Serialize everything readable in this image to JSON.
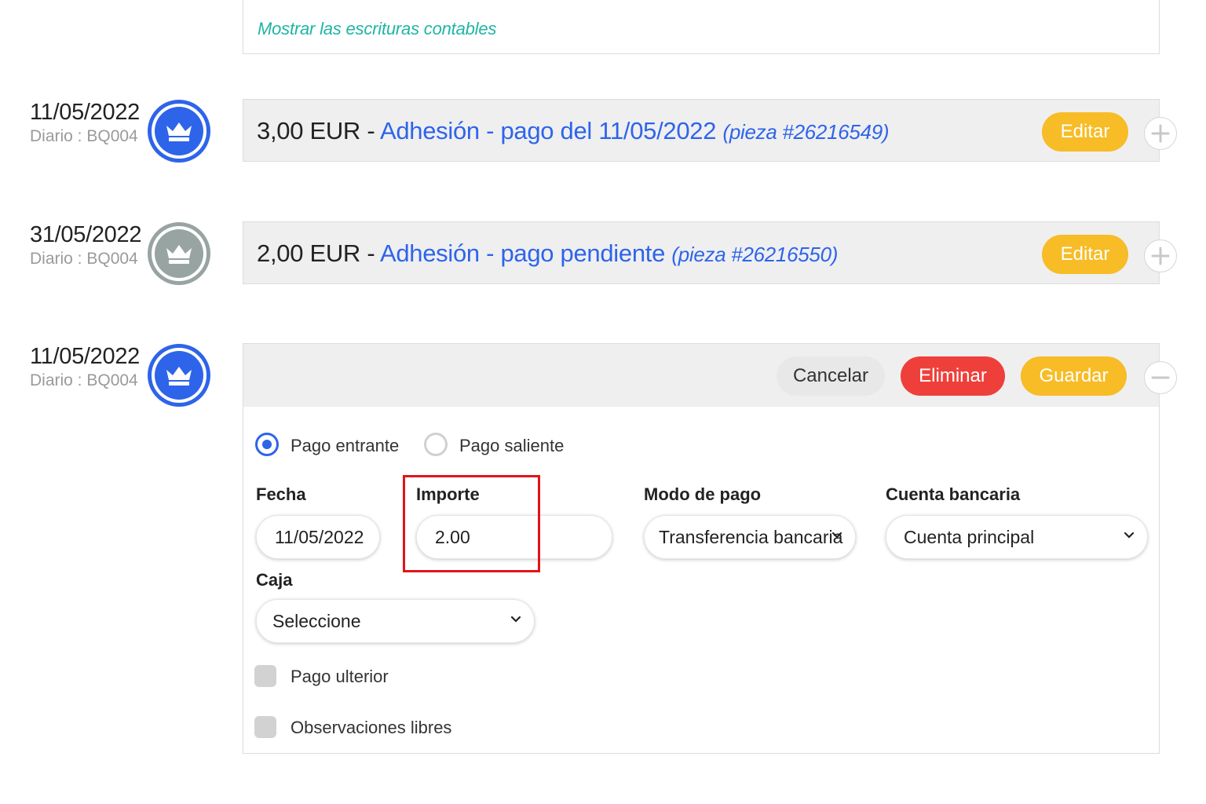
{
  "top": {
    "link": "Mostrar las escrituras contables"
  },
  "entries": [
    {
      "date": "11/05/2022",
      "journal": "Diario : BQ004",
      "amount": "3,00 EUR",
      "sep": " - ",
      "title": "Adhesión - pago del 11/05/2022",
      "piece": "(pieza #26216549)",
      "edit_label": "Editar",
      "status_color": "#2e64ea"
    },
    {
      "date": "31/05/2022",
      "journal": "Diario : BQ004",
      "amount": "2,00 EUR",
      "sep": " - ",
      "title": "Adhesión - pago pendiente",
      "piece": "(pieza #26216550)",
      "edit_label": "Editar",
      "status_color": "#98a4a2"
    }
  ],
  "editing": {
    "date": "11/05/2022",
    "journal": "Diario : BQ004",
    "cancel_label": "Cancelar",
    "delete_label": "Eliminar",
    "save_label": "Guardar",
    "direction": {
      "incoming": "Pago entrante",
      "outgoing": "Pago saliente",
      "selected": "incoming"
    },
    "fields": {
      "fecha_label": "Fecha",
      "fecha_value": "11/05/2022",
      "importe_label": "Importe",
      "importe_value": "2.00",
      "modo_label": "Modo de pago",
      "modo_value": "Transferencia bancaria",
      "cuenta_label": "Cuenta bancaria",
      "cuenta_value": "Cuenta principal",
      "caja_label": "Caja",
      "caja_value": "Seleccione"
    },
    "checkboxes": {
      "pago_ulterior": "Pago ulterior",
      "observaciones": "Observaciones libres"
    }
  },
  "colors": {
    "accent_blue": "#2e64ea",
    "teal_link": "#1fb5a6",
    "yellow": "#f7bc26",
    "red": "#ef3f3a",
    "highlight": "#e0141a"
  }
}
